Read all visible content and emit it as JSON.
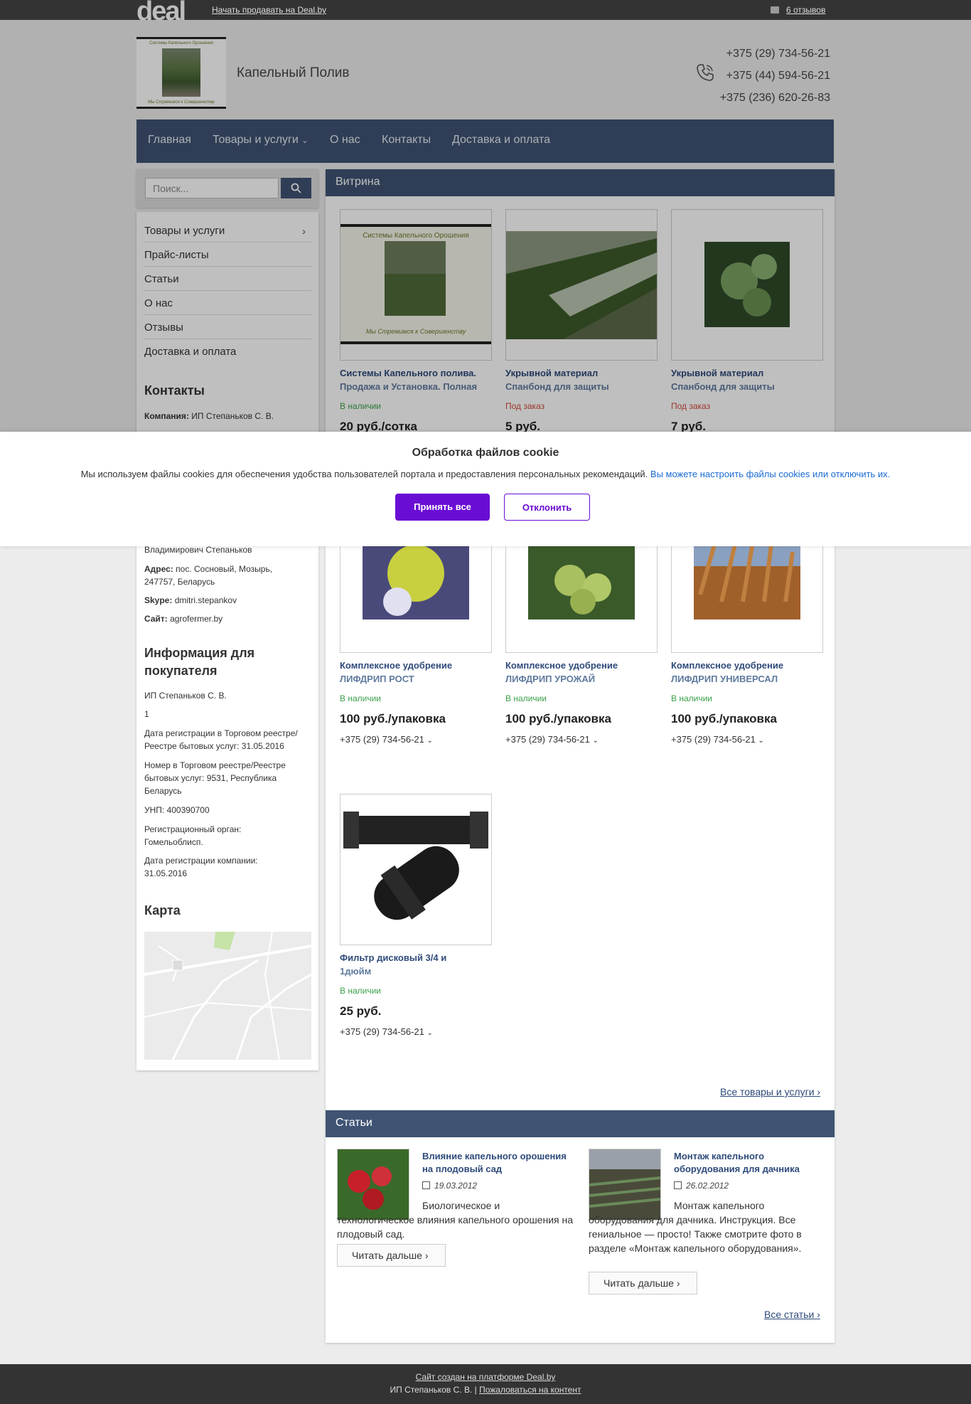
{
  "topbar": {
    "logo": "deal",
    "sell_link": "Начать продавать на Deal.by",
    "reviews_link": "6 отзывов"
  },
  "header": {
    "logo_caption_top": "Системы Капельного Орошения",
    "logo_caption_bottom": "Мы Стремимся к Совершенству",
    "company_name": "Капельный Полив",
    "phones": [
      "+375 (29) 734-56-21",
      "+375 (44) 594-56-21",
      "+375 (236) 620-26-83"
    ]
  },
  "nav": {
    "items": [
      "Главная",
      "Товары и услуги",
      "О нас",
      "Контакты",
      "Доставка и оплата"
    ]
  },
  "search": {
    "placeholder": "Поиск..."
  },
  "sidebar": {
    "menu": [
      "Товары и услуги",
      "Прайс-листы",
      "Статьи",
      "О нас",
      "Отзывы",
      "Доставка и оплата"
    ],
    "contacts_title": "Контакты",
    "company_label": "Компания:",
    "company_value": "ИП Степаньков С. В.",
    "contact_person_tail": "Владимирович Степаньков",
    "address_label": "Адрес:",
    "address_value": "пос. Сосновый, Мозырь, 247757, Беларусь",
    "skype_label": "Skype:",
    "skype_value": "dmitri.stepankov",
    "site_label": "Сайт:",
    "site_value": "agrofermer.by",
    "info_title": "Информация для покупателя",
    "info_rows": [
      "ИП Степаньков С. В.",
      "1",
      "Дата регистрации в Торговом реестре/Реестре бытовых услуг: 31.05.2016",
      "Номер в Торговом реестре/Реестре бытовых услуг: 9531, Республика Беларусь",
      "УНП: 400390700",
      "Регистрационный орган: Гомельоблисп.",
      "Дата регистрации компании: 31.05.2016"
    ],
    "map_title": "Карта"
  },
  "showcase": {
    "title": "Витрина",
    "products": [
      {
        "title1": "Системы Капельного полива.",
        "title2": "Продажа и Установка. Полная",
        "stock": "В наличии",
        "price": "20 руб./сотка",
        "phone": ""
      },
      {
        "title1": "Укрывной материал",
        "title2": "Спанбонд для защиты",
        "stock": "Под заказ",
        "price": "5 руб.",
        "phone": ""
      },
      {
        "title1": "Укрывной материал",
        "title2": "Спанбонд для защиты",
        "stock": "Под заказ",
        "price": "7 руб.",
        "phone": ""
      },
      {
        "title1": "Комплексное удобрение",
        "title2": "ЛИФДРИП РОСТ",
        "stock": "В наличии",
        "price": "100 руб./упаковка",
        "phone": "+375 (29) 734-56-21"
      },
      {
        "title1": "Комплексное удобрение",
        "title2": "ЛИФДРИП УРОЖАЙ",
        "stock": "В наличии",
        "price": "100 руб./упаковка",
        "phone": "+375 (29) 734-56-21"
      },
      {
        "title1": "Комплексное удобрение",
        "title2": "ЛИФДРИП УНИВЕРСАЛ",
        "stock": "В наличии",
        "price": "100 руб./упаковка",
        "phone": "+375 (29) 734-56-21"
      },
      {
        "title1": "Фильтр дисковый 3/4 и",
        "title2": "1дюйм",
        "stock": "В наличии",
        "price": "25 руб.",
        "phone": "+375 (29) 734-56-21"
      }
    ],
    "all_link": "Все товары и услуги"
  },
  "articles": {
    "title": "Статьи",
    "items": [
      {
        "title": "Влияние капельного орошения на плодовый сад",
        "date": "19.03.2012",
        "text": "Биологическое и технологическое влияния капельного орошения на плодовый сад.",
        "more": "Читать дальше"
      },
      {
        "title": "Монтаж капельного оборудования для дачника",
        "date": "26.02.2012",
        "text": "Монтаж капельного оборудования для дачника. Инструкция. Все гениальное — просто! Также смотрите фото в разделе «Монтаж капельного оборудования».",
        "more": "Читать дальше"
      }
    ],
    "all_link": "Все статьи"
  },
  "cookie": {
    "title": "Обработка файлов cookie",
    "text": "Мы используем файлы cookies для обеспечения удобства пользователей портала и предоставления персональных рекомендаций.",
    "link": "Вы можете настроить файлы cookies или отключить их.",
    "accept": "Принять все",
    "decline": "Отклонить"
  },
  "footer": {
    "created": "Сайт создан на платформе Deal.by",
    "company": "ИП Степаньков С. В. |",
    "complain": "Пожаловаться на контент"
  },
  "colors": {
    "nav_bg": "#3f5373",
    "accent_purple": "#6a0dd4",
    "in_stock": "#3aa04a",
    "on_order": "#d04a3a",
    "link_blue": "#2e4a7a"
  }
}
